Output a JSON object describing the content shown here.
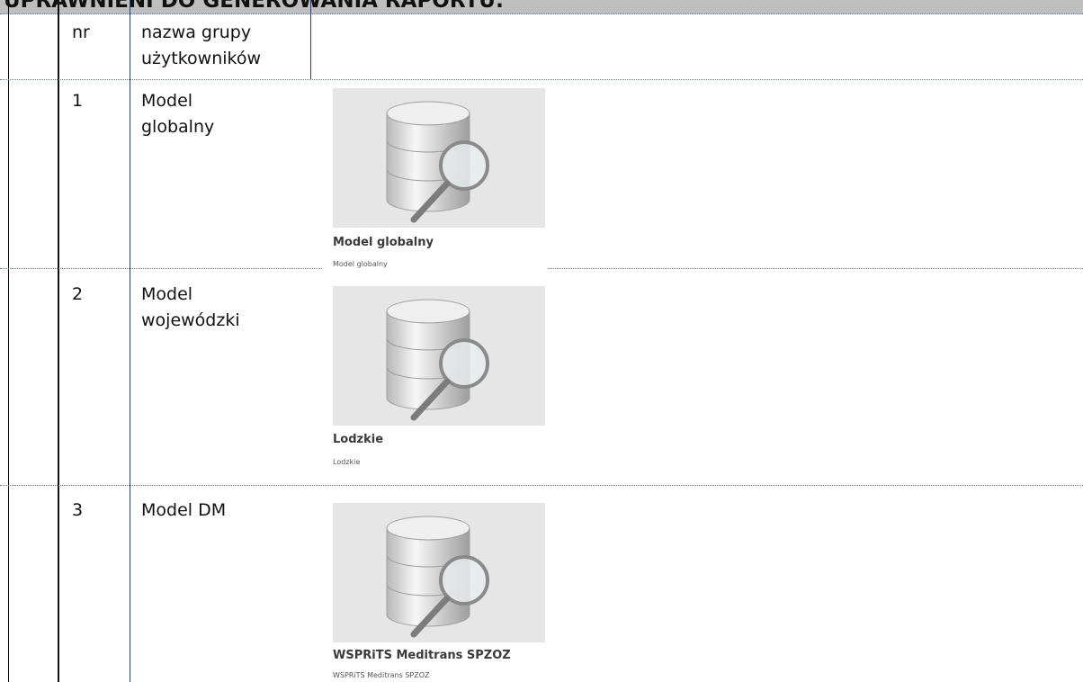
{
  "section_title": "UPRAWNIENI DO GENEROWANIA RAPORTU:",
  "table": {
    "headers": {
      "nr": "nr",
      "group_name_line1": "nazwa grupy",
      "group_name_line2": "użytkowników"
    },
    "rows": [
      {
        "nr": "1",
        "name_line1": "Model",
        "name_line2": "globalny",
        "card_title": "Model globalny",
        "card_subtitle": "Model globalny",
        "icon": "database-search-icon"
      },
      {
        "nr": "2",
        "name_line1": "Model",
        "name_line2": "wojewódzki",
        "card_title": "Lodzkie",
        "card_subtitle": "Lodzkie",
        "icon": "database-search-icon"
      },
      {
        "nr": "3",
        "name_line1": "Model DM",
        "name_line2": "",
        "card_title": "WSPRiTS Meditrans SPZOZ",
        "card_subtitle": "WSPRiTS Meditrans SPZOZ",
        "icon": "database-search-icon"
      }
    ]
  },
  "colors": {
    "header_bg": "#bfbfbf",
    "row_divider": "#5a78b4",
    "column_divider": "#1f3f8f",
    "card_bg": "#e6e6e6"
  }
}
